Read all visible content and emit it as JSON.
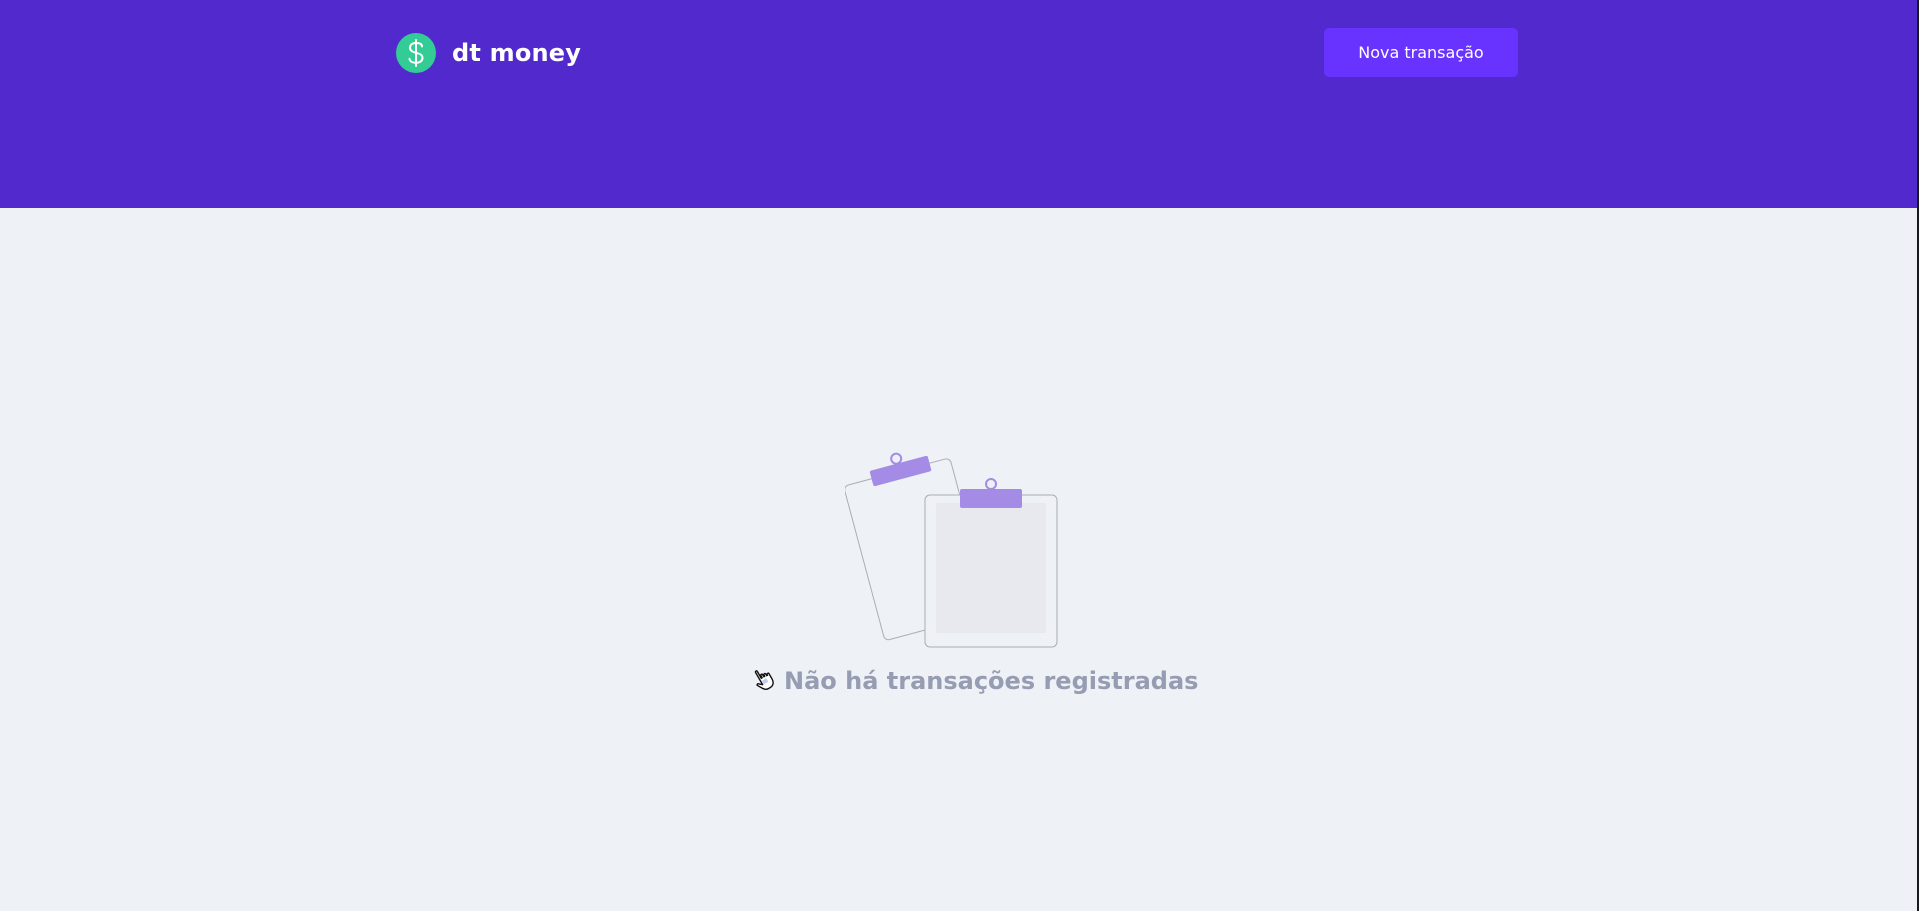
{
  "header": {
    "brand": "dt money",
    "logo_icon": "dollar-sign-icon",
    "new_transaction_label": "Nova transação"
  },
  "empty_state": {
    "illustration_icon": "clipboards-illustration",
    "cursor_icon": "hand-pointer-icon",
    "message": "Não há transações registradas"
  },
  "colors": {
    "header_bg": "#5229cc",
    "button_bg": "#6933ff",
    "logo_green": "#33cc95",
    "page_bg": "#eef1f5",
    "muted_text": "#969cb2",
    "clip_purple": "#a38be6"
  }
}
